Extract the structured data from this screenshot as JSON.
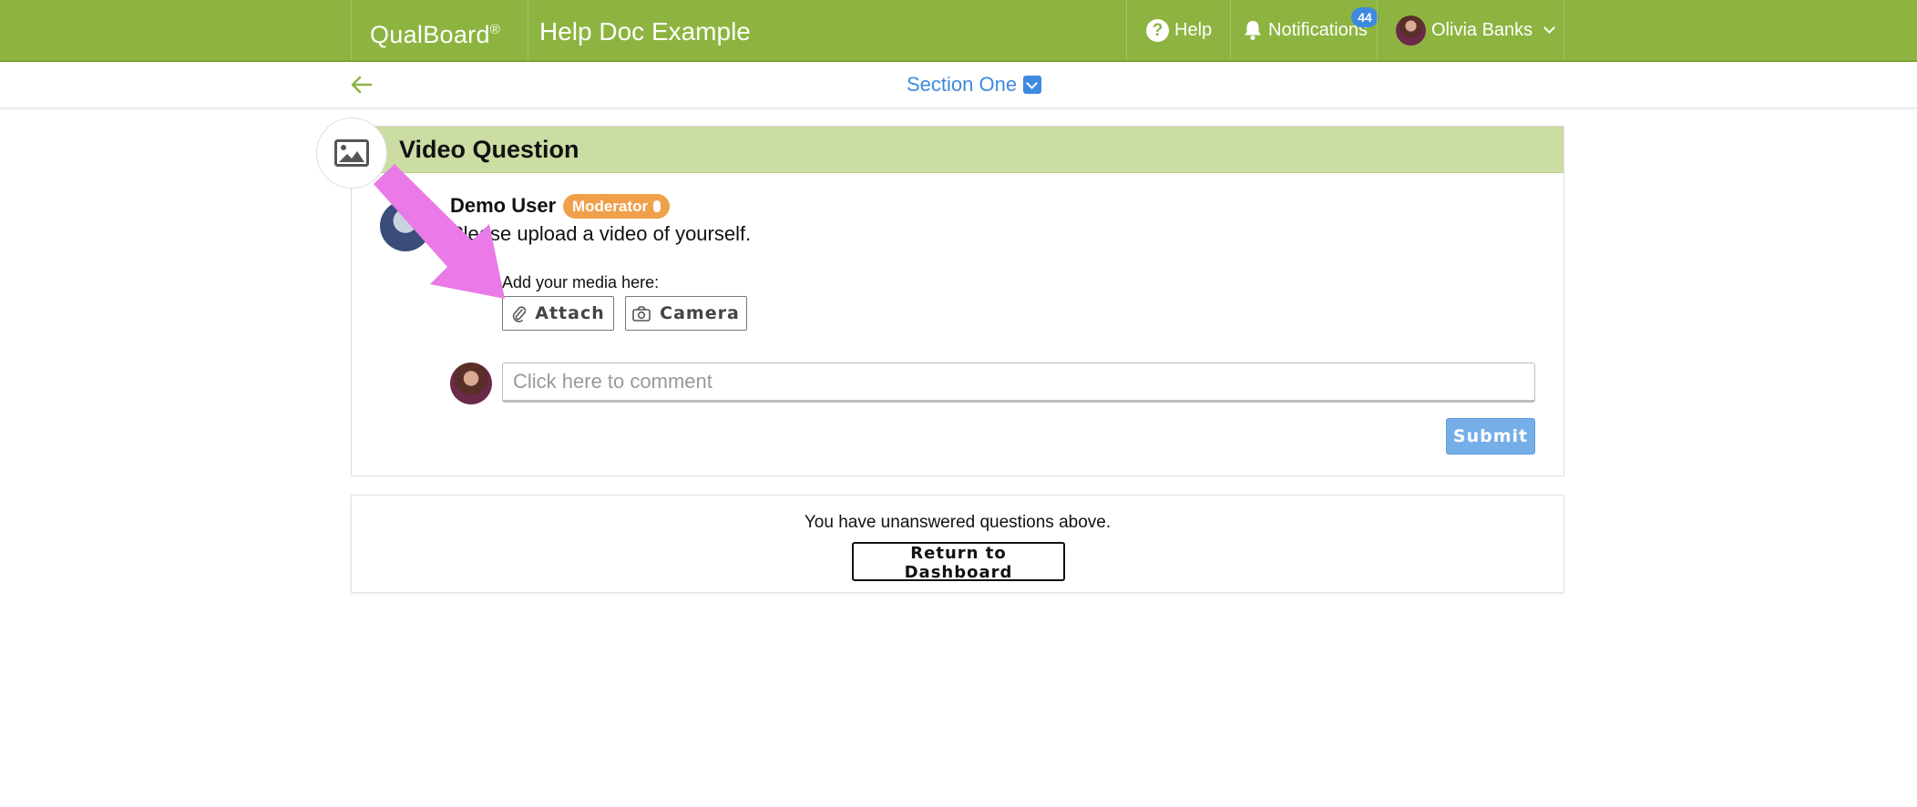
{
  "header": {
    "brand": "QualBoard",
    "brand_mark": "®",
    "project_title": "Help Doc Example",
    "help_label": "Help",
    "notifications_label": "Notifications",
    "notifications_count": "44",
    "user_name": "Olivia Banks"
  },
  "section": {
    "title": "Section One"
  },
  "question": {
    "title": "Video Question",
    "poster_name": "Demo User",
    "poster_role": "Moderator",
    "prompt": "Please upload a video of yourself.",
    "media_label": "Add your media here:",
    "attach_label": "Attach",
    "camera_label": "Camera",
    "comment_placeholder": "Click here to comment",
    "submit_label": "Submit"
  },
  "notice": {
    "text": "You have unanswered questions above.",
    "dashboard_label": "Return to Dashboard"
  },
  "colors": {
    "brand_green": "#8db440",
    "header_light_green": "#cbdda3",
    "link_blue": "#3d8ae0",
    "moderator_orange": "#f0a04b",
    "submit_blue": "#76aee8",
    "annotation_pink": "#e97ae8"
  },
  "icons": {
    "help": "question-circle-icon",
    "notifications": "bell-icon",
    "back": "arrow-left-icon",
    "question_type": "image-icon",
    "attach": "paperclip-icon",
    "camera": "camera-icon",
    "moderator": "microphone-icon"
  }
}
